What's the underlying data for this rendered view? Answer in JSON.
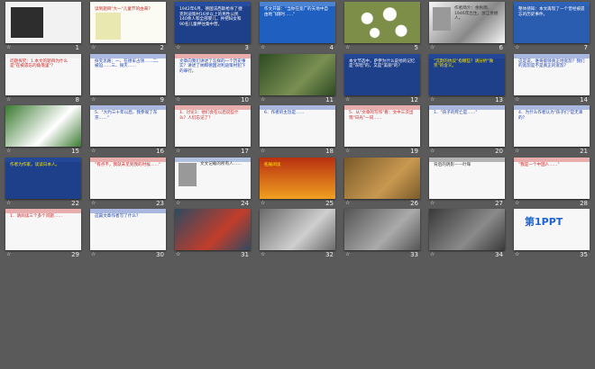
{
  "app": {
    "view": "Slide Sorter"
  },
  "slides": [
    {
      "n": "1",
      "bg": "#f2f2f2",
      "accent": "#2d2d2d",
      "text": "",
      "tc": "#111"
    },
    {
      "n": "2",
      "bg": "#fbfbf3",
      "accent": "#e8e8b0",
      "text": "读到题目\"大一\"儿童节的由来？",
      "tc": "#c22"
    },
    {
      "n": "3",
      "bg": "#1e3f8a",
      "accent": "#3a66c8",
      "text": "1942年6月，德国法西斯枪杀了捷克利迪策村16岁以上的男性公民140余人和全部婴儿，并把妇女和90名儿童押往集中营。",
      "tc": "#fff"
    },
    {
      "n": "4",
      "bg": "#1f5fc0",
      "accent": "#9fc7f0",
      "text": "作文开篇：\"当你在宽广的天地中自由地飞翔时……\"",
      "tc": "#fff"
    },
    {
      "n": "5",
      "bg": "#7d8e48",
      "accent": "#f0f0f0",
      "text": "",
      "tc": "#fff"
    },
    {
      "n": "6",
      "bg": "#f7f7f7",
      "accent": "#888",
      "text": "作者简介：余秋雨，1946年出生，浙江余姚人。",
      "tc": "#333"
    },
    {
      "n": "7",
      "bg": "#2a5cb0",
      "accent": "#3a70c8",
      "text": "整体感知：本文再现了一个曾经被遗忘的历史事件。",
      "tc": "#fff"
    },
    {
      "n": "8",
      "bg": "#f7f7f7",
      "accent": "#e0e0e0",
      "text": "问题探究：1.本文的题目为什么是\"在被遗忘的角落里\"？",
      "tc": "#c22"
    },
    {
      "n": "9",
      "bg": "#fafafa",
      "accent": "#1b3fb0",
      "text": "探究思路：一、在德军占领……二、被迫……三、毁灭……",
      "tc": "#1b3fb0"
    },
    {
      "n": "10",
      "bg": "#f7f7f7",
      "accent": "#c22",
      "text": "文章向我们讲述了怎样的一个历史事实？讲述了纳粹德国对利迪策村犯下的罪行。",
      "tc": "#1b3fb0"
    },
    {
      "n": "11",
      "bg": "#2d4a22",
      "accent": "#7a8f52",
      "text": "",
      "tc": "#fff"
    },
    {
      "n": "12",
      "bg": "#1e3f8a",
      "accent": "#2f58b0",
      "text": "本文节选中，萨伊为什么说他的记忆是\"灰暗\"的，又是\"美丽\"的？",
      "tc": "#fff"
    },
    {
      "n": "13",
      "bg": "#1e3f8a",
      "accent": "#2f58b0",
      "text": "\"沉默的抗议\"指哪些？请分析\"微笑\"的含义。",
      "tc": "#ffea00"
    },
    {
      "n": "14",
      "bg": "#f7f7f7",
      "accent": "#1b3fb0",
      "text": "这是说，谁将能够真正地宽恕？我们的宽恕是不是真正的宽恕？",
      "tc": "#1b3fb0"
    },
    {
      "n": "15",
      "bg": "#3a7a30",
      "accent": "#ffffff",
      "text": "",
      "tc": "#fff"
    },
    {
      "n": "16",
      "bg": "#f7f7f7",
      "accent": "#1b3fb0",
      "text": "5．\"大约三十年以后，我参观了东京……\"",
      "tc": "#1b3fb0"
    },
    {
      "n": "17",
      "bg": "#f7f7f7",
      "accent": "#c22",
      "text": "1．讨论1：他们会在以后说些什么？人们忘记了？",
      "tc": "#c22"
    },
    {
      "n": "18",
      "bg": "#f7f7f7",
      "accent": "#1b3fb0",
      "text": "6．作者的主旨是……",
      "tc": "#1b3fb0"
    },
    {
      "n": "19",
      "bg": "#f7f7f7",
      "accent": "#c22",
      "text": "5．从\"文章的写作\"看：文中三次出现\"日光\"一词……",
      "tc": "#c22"
    },
    {
      "n": "20",
      "bg": "#f7f7f7",
      "accent": "#1b3fb0",
      "text": "1．\"孩子的死亡是……\"",
      "tc": "#1b3fb0"
    },
    {
      "n": "21",
      "bg": "#f7f7f7",
      "accent": "#1b3fb0",
      "text": "4．为什么作者认为\"孩子们\"是无辜的？",
      "tc": "#1b3fb0"
    },
    {
      "n": "22",
      "bg": "#1e3f8a",
      "accent": "#2f58b0",
      "text": "作者为作家，读读日本人。",
      "tc": "#ffea00"
    },
    {
      "n": "23",
      "bg": "#f7f7f7",
      "accent": "#c22",
      "text": "\"有点不，我就未见到我的时候……\"",
      "tc": "#c22"
    },
    {
      "n": "24",
      "bg": "#f7f7f7",
      "accent": "#2f58b0",
      "text": "文文记载的所有人……",
      "tc": "#333"
    },
    {
      "n": "25",
      "bg": "#b83010",
      "accent": "#f0a020",
      "text": "拓展阅读",
      "tc": "#ffea00"
    },
    {
      "n": "26",
      "bg": "#7a5a2a",
      "accent": "#c89850",
      "text": "",
      "tc": "#fff"
    },
    {
      "n": "27",
      "bg": "#f7f7f7",
      "accent": "#333",
      "text": "背后的阴影——叶晖",
      "tc": "#333"
    },
    {
      "n": "28",
      "bg": "#f7f7f7",
      "accent": "#c22",
      "text": "\"我是一个中国人……\"",
      "tc": "#c22"
    },
    {
      "n": "29",
      "bg": "#f7f7f7",
      "accent": "#c22",
      "text": "1．请阅读三个多个问题……",
      "tc": "#c22"
    },
    {
      "n": "30",
      "bg": "#f7f7f7",
      "accent": "#1b3fb0",
      "text": "这篇文章作者写了什么？",
      "tc": "#1b3fb0"
    },
    {
      "n": "31",
      "bg": "#2e4a60",
      "accent": "#c23d2b",
      "text": "",
      "tc": "#fff"
    },
    {
      "n": "32",
      "bg": "#6a6a6a",
      "accent": "#cfcfcf",
      "text": "",
      "tc": "#fff"
    },
    {
      "n": "33",
      "bg": "#555",
      "accent": "#aaa",
      "text": "",
      "tc": "#fff"
    },
    {
      "n": "34",
      "bg": "#3a3a3a",
      "accent": "#8a8a8a",
      "text": "",
      "tc": "#fff"
    },
    {
      "n": "35",
      "bg": "#f7f7f7",
      "accent": "#1e64d0",
      "text": "第1PPT",
      "tc": "#1e64d0"
    }
  ]
}
